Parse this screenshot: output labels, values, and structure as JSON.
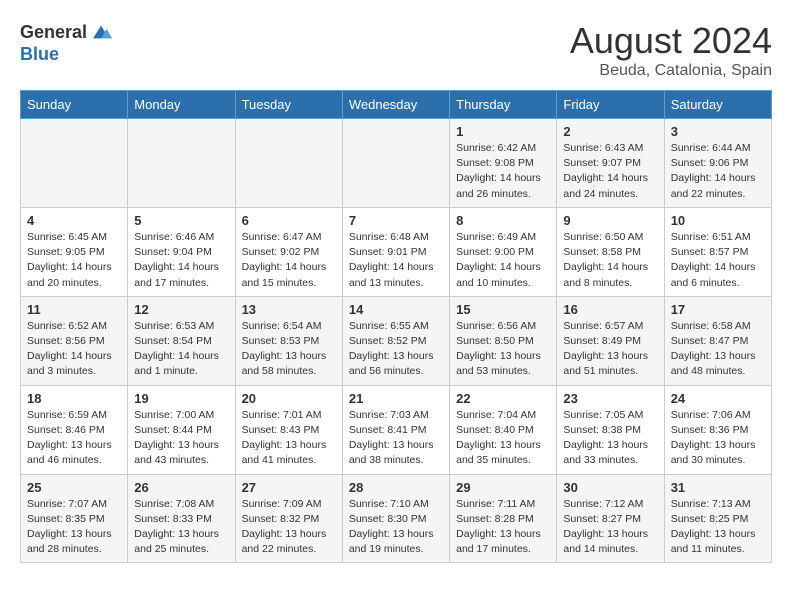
{
  "logo": {
    "general": "General",
    "blue": "Blue"
  },
  "title": "August 2024",
  "subtitle": "Beuda, Catalonia, Spain",
  "days_of_week": [
    "Sunday",
    "Monday",
    "Tuesday",
    "Wednesday",
    "Thursday",
    "Friday",
    "Saturday"
  ],
  "weeks": [
    [
      {
        "day": "",
        "info": ""
      },
      {
        "day": "",
        "info": ""
      },
      {
        "day": "",
        "info": ""
      },
      {
        "day": "",
        "info": ""
      },
      {
        "day": "1",
        "info": "Sunrise: 6:42 AM\nSunset: 9:08 PM\nDaylight: 14 hours\nand 26 minutes."
      },
      {
        "day": "2",
        "info": "Sunrise: 6:43 AM\nSunset: 9:07 PM\nDaylight: 14 hours\nand 24 minutes."
      },
      {
        "day": "3",
        "info": "Sunrise: 6:44 AM\nSunset: 9:06 PM\nDaylight: 14 hours\nand 22 minutes."
      }
    ],
    [
      {
        "day": "4",
        "info": "Sunrise: 6:45 AM\nSunset: 9:05 PM\nDaylight: 14 hours\nand 20 minutes."
      },
      {
        "day": "5",
        "info": "Sunrise: 6:46 AM\nSunset: 9:04 PM\nDaylight: 14 hours\nand 17 minutes."
      },
      {
        "day": "6",
        "info": "Sunrise: 6:47 AM\nSunset: 9:02 PM\nDaylight: 14 hours\nand 15 minutes."
      },
      {
        "day": "7",
        "info": "Sunrise: 6:48 AM\nSunset: 9:01 PM\nDaylight: 14 hours\nand 13 minutes."
      },
      {
        "day": "8",
        "info": "Sunrise: 6:49 AM\nSunset: 9:00 PM\nDaylight: 14 hours\nand 10 minutes."
      },
      {
        "day": "9",
        "info": "Sunrise: 6:50 AM\nSunset: 8:58 PM\nDaylight: 14 hours\nand 8 minutes."
      },
      {
        "day": "10",
        "info": "Sunrise: 6:51 AM\nSunset: 8:57 PM\nDaylight: 14 hours\nand 6 minutes."
      }
    ],
    [
      {
        "day": "11",
        "info": "Sunrise: 6:52 AM\nSunset: 8:56 PM\nDaylight: 14 hours\nand 3 minutes."
      },
      {
        "day": "12",
        "info": "Sunrise: 6:53 AM\nSunset: 8:54 PM\nDaylight: 14 hours\nand 1 minute."
      },
      {
        "day": "13",
        "info": "Sunrise: 6:54 AM\nSunset: 8:53 PM\nDaylight: 13 hours\nand 58 minutes."
      },
      {
        "day": "14",
        "info": "Sunrise: 6:55 AM\nSunset: 8:52 PM\nDaylight: 13 hours\nand 56 minutes."
      },
      {
        "day": "15",
        "info": "Sunrise: 6:56 AM\nSunset: 8:50 PM\nDaylight: 13 hours\nand 53 minutes."
      },
      {
        "day": "16",
        "info": "Sunrise: 6:57 AM\nSunset: 8:49 PM\nDaylight: 13 hours\nand 51 minutes."
      },
      {
        "day": "17",
        "info": "Sunrise: 6:58 AM\nSunset: 8:47 PM\nDaylight: 13 hours\nand 48 minutes."
      }
    ],
    [
      {
        "day": "18",
        "info": "Sunrise: 6:59 AM\nSunset: 8:46 PM\nDaylight: 13 hours\nand 46 minutes."
      },
      {
        "day": "19",
        "info": "Sunrise: 7:00 AM\nSunset: 8:44 PM\nDaylight: 13 hours\nand 43 minutes."
      },
      {
        "day": "20",
        "info": "Sunrise: 7:01 AM\nSunset: 8:43 PM\nDaylight: 13 hours\nand 41 minutes."
      },
      {
        "day": "21",
        "info": "Sunrise: 7:03 AM\nSunset: 8:41 PM\nDaylight: 13 hours\nand 38 minutes."
      },
      {
        "day": "22",
        "info": "Sunrise: 7:04 AM\nSunset: 8:40 PM\nDaylight: 13 hours\nand 35 minutes."
      },
      {
        "day": "23",
        "info": "Sunrise: 7:05 AM\nSunset: 8:38 PM\nDaylight: 13 hours\nand 33 minutes."
      },
      {
        "day": "24",
        "info": "Sunrise: 7:06 AM\nSunset: 8:36 PM\nDaylight: 13 hours\nand 30 minutes."
      }
    ],
    [
      {
        "day": "25",
        "info": "Sunrise: 7:07 AM\nSunset: 8:35 PM\nDaylight: 13 hours\nand 28 minutes."
      },
      {
        "day": "26",
        "info": "Sunrise: 7:08 AM\nSunset: 8:33 PM\nDaylight: 13 hours\nand 25 minutes."
      },
      {
        "day": "27",
        "info": "Sunrise: 7:09 AM\nSunset: 8:32 PM\nDaylight: 13 hours\nand 22 minutes."
      },
      {
        "day": "28",
        "info": "Sunrise: 7:10 AM\nSunset: 8:30 PM\nDaylight: 13 hours\nand 19 minutes."
      },
      {
        "day": "29",
        "info": "Sunrise: 7:11 AM\nSunset: 8:28 PM\nDaylight: 13 hours\nand 17 minutes."
      },
      {
        "day": "30",
        "info": "Sunrise: 7:12 AM\nSunset: 8:27 PM\nDaylight: 13 hours\nand 14 minutes."
      },
      {
        "day": "31",
        "info": "Sunrise: 7:13 AM\nSunset: 8:25 PM\nDaylight: 13 hours\nand 11 minutes."
      }
    ]
  ]
}
